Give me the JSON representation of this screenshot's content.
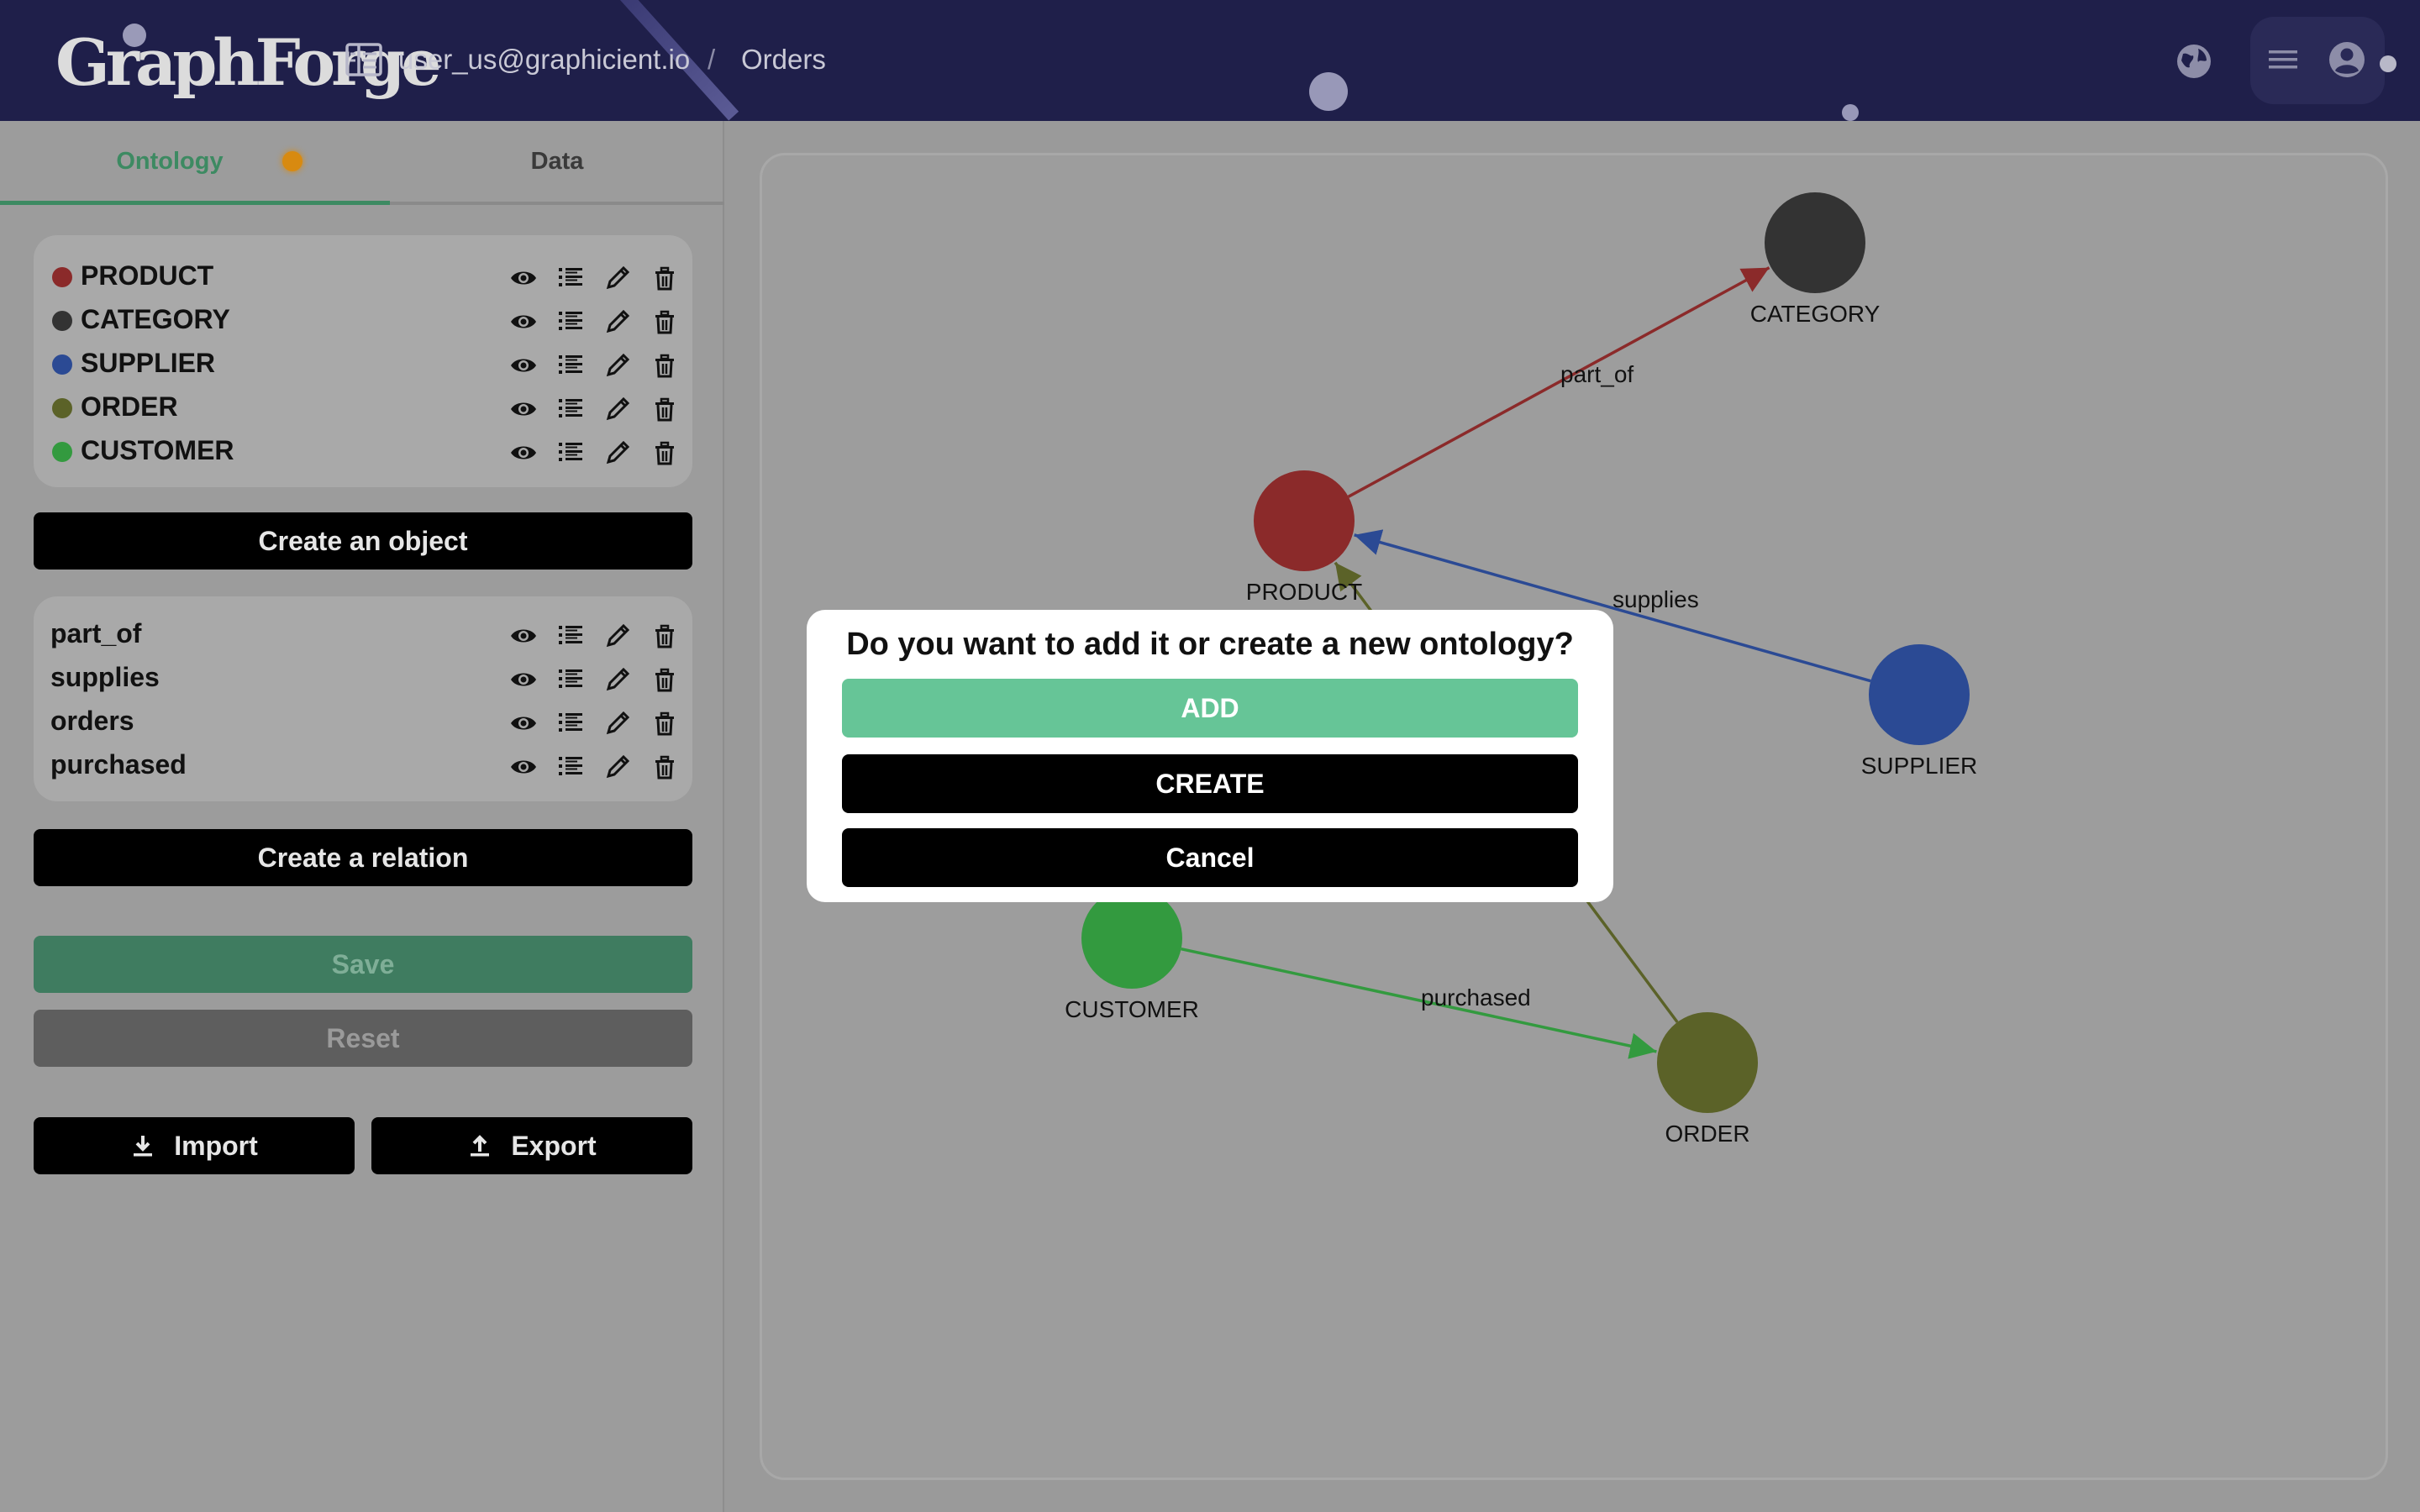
{
  "header": {
    "logo_text": "GraphForge",
    "breadcrumb_user": "user_us@graphicient.io",
    "breadcrumb_sep": "/",
    "breadcrumb_page": "Orders"
  },
  "sidebar": {
    "tabs": [
      {
        "label": "Ontology",
        "active": true,
        "has_indicator": true
      },
      {
        "label": "Data",
        "active": false
      }
    ],
    "objects": [
      {
        "name": "PRODUCT",
        "color": "#8b2a2a"
      },
      {
        "name": "CATEGORY",
        "color": "#333333"
      },
      {
        "name": "SUPPLIER",
        "color": "#2b4a94"
      },
      {
        "name": "ORDER",
        "color": "#5b6228"
      },
      {
        "name": "CUSTOMER",
        "color": "#339a3f"
      }
    ],
    "create_object_label": "Create an object",
    "relations": [
      {
        "name": "part_of"
      },
      {
        "name": "supplies"
      },
      {
        "name": "orders"
      },
      {
        "name": "purchased"
      }
    ],
    "create_relation_label": "Create a relation",
    "save_label": "Save",
    "reset_label": "Reset",
    "import_label": "Import",
    "export_label": "Export"
  },
  "graph": {
    "nodes": [
      {
        "id": "CATEGORY",
        "label": "CATEGORY",
        "color": "#333333"
      },
      {
        "id": "PRODUCT",
        "label": "PRODUCT",
        "color": "#8b2a2a"
      },
      {
        "id": "SUPPLIER",
        "label": "SUPPLIER",
        "color": "#2b4a94"
      },
      {
        "id": "CUSTOMER",
        "label": "CUSTOMER",
        "color": "#339a3f"
      },
      {
        "id": "ORDER",
        "label": "ORDER",
        "color": "#5b6228"
      }
    ],
    "edges": [
      {
        "label": "part_of",
        "color": "#8b2a2a"
      },
      {
        "label": "supplies",
        "color": "#2b4a94"
      },
      {
        "label": "purchased",
        "color": "#339a3f"
      },
      {
        "label": "orders",
        "color": "#5b6228"
      }
    ]
  },
  "dialog": {
    "title": "Do you want to add it or create a new ontology?",
    "add_label": "ADD",
    "create_label": "CREATE",
    "cancel_label": "Cancel"
  },
  "colors": {
    "header_bg": "#1f1f4a",
    "accent_green": "#3d8a62",
    "tab_indicator": "#d88a10",
    "add_button": "#66c597"
  }
}
